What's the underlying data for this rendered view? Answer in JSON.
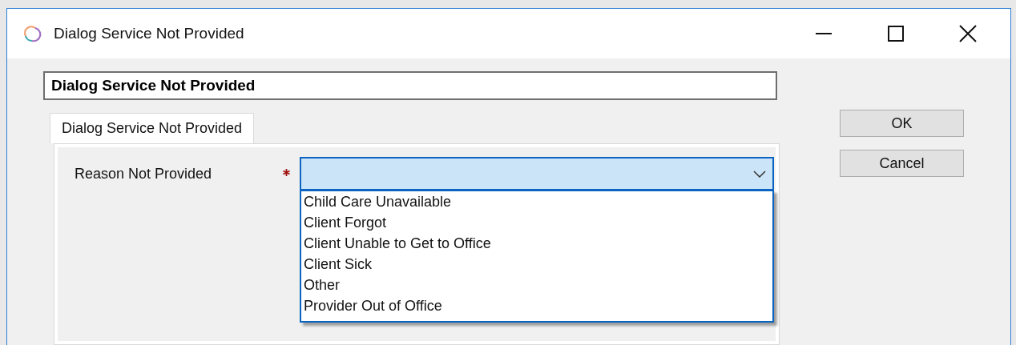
{
  "window": {
    "title": "Dialog Service Not Provided"
  },
  "name_field": {
    "value": "Dialog Service Not Provided"
  },
  "tabs": [
    {
      "label": "Dialog Service Not Provided",
      "selected": true
    }
  ],
  "form": {
    "label": "Reason Not Provided",
    "required": true,
    "combobox": {
      "expanded": true,
      "options": [
        {
          "label": "Child Care Unavailable",
          "selected": false
        },
        {
          "label": "Client Forgot",
          "selected": false
        },
        {
          "label": "Client Unable to Get to Office",
          "selected": false
        },
        {
          "label": "Client Sick",
          "selected": false
        },
        {
          "label": "Other",
          "selected": false
        },
        {
          "label": "Provider Out of Office",
          "selected": false
        }
      ]
    }
  },
  "buttons": [
    "OK",
    "Cancel"
  ]
}
